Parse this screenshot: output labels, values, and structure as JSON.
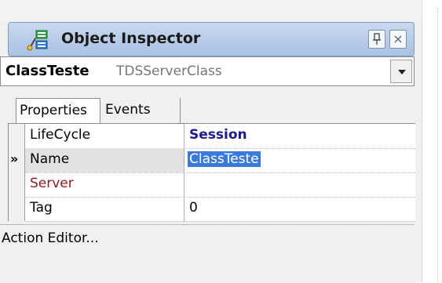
{
  "title": "Object Inspector",
  "selector": {
    "component_name": "ClassTeste",
    "component_type": "TDSServerClass"
  },
  "tabs": [
    {
      "label": "Properties",
      "active": true
    },
    {
      "label": "Events",
      "active": false
    }
  ],
  "properties": [
    {
      "name": "LifeCycle",
      "value": "Session"
    },
    {
      "name": "Name",
      "value": "ClassTeste",
      "selected": true
    },
    {
      "name": "Server",
      "value": ""
    },
    {
      "name": "Tag",
      "value": "0"
    }
  ],
  "current_row_marker": "»",
  "action_editor_label": "Action Editor...",
  "icons": {
    "title": "object-inspector-icon",
    "pin": "pin-icon",
    "close": "close-icon",
    "dropdown": "dropdown-arrow-icon"
  },
  "colors": {
    "titlebar": "#b8cce8",
    "selection": "#3b7ad8",
    "reference_property": "#8b1a1a",
    "value_bold": "#1a1a8c"
  }
}
